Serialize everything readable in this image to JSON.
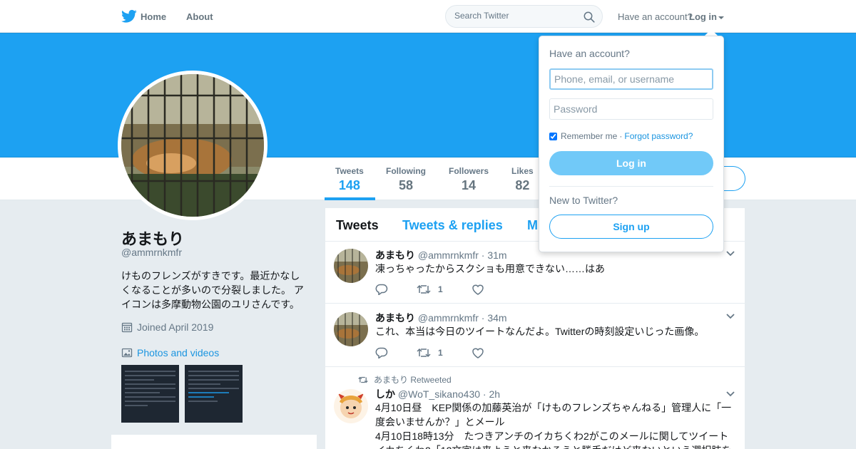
{
  "nav": {
    "home_label": "Home",
    "about_label": "About",
    "search_placeholder": "Search Twitter",
    "have_account_label": "Have an account?",
    "login_label": "Log in"
  },
  "colors": {
    "brand_blue": "#1da1f2",
    "link_blue": "#1b95e0",
    "secondary_text": "#657786"
  },
  "profile": {
    "name": "あまもり",
    "handle": "@ammrnkmfr",
    "bio": "けものフレンズがすきです。最近かなしくなることが多いので分裂しました。 アイコンは多摩動物公園のユリさんです。",
    "joined": "Joined April 2019",
    "photos_label": "Photos and videos",
    "stats": [
      {
        "label": "Tweets",
        "value": "148"
      },
      {
        "label": "Following",
        "value": "58"
      },
      {
        "label": "Followers",
        "value": "14"
      },
      {
        "label": "Likes",
        "value": "82"
      }
    ]
  },
  "timeline": {
    "tabs": [
      "Tweets",
      "Tweets & replies",
      "M"
    ],
    "tweets": [
      {
        "name": "あまもり",
        "handle": "@ammrnkmfr",
        "time": "· 31m",
        "text": "凍っちゃったからスクショも用意できない……はあ",
        "retweets": "1"
      },
      {
        "name": "あまもり",
        "handle": "@ammrnkmfr",
        "time": "· 34m",
        "text": "これ、本当は今日のツイートなんだよ。Twitterの時刻設定いじった画像。",
        "retweets": "1"
      },
      {
        "context": "あまもり Retweeted",
        "name": "しか",
        "handle": "@WoT_sikano430",
        "time": "· 2h",
        "text1": "4月10日昼　KEP関係の加藤英治が「けものフレンズちゃんねる」管理人に「一度会いませんか？」とメール",
        "text2": "4月10日18時13分　たつきアンチのイカちくわ2がこのメールに関してツイート",
        "text3": "イカちくわ2「12文字は来ようと来なかろうと勝手だけど来ないという選択肢を"
      }
    ]
  },
  "login_dropdown": {
    "title": "Have an account?",
    "username_placeholder": "Phone, email, or username",
    "password_placeholder": "Password",
    "remember_label": "Remember me",
    "separator": "·",
    "forgot_label": "Forgot password?",
    "login_button": "Log in",
    "new_label": "New to Twitter?",
    "signup_button": "Sign up"
  }
}
